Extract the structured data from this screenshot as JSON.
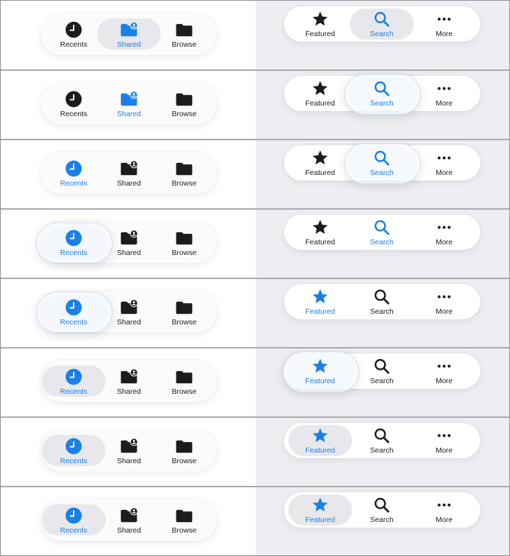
{
  "colors": {
    "accent": "#1a80e6",
    "icon_dark": "#1c1c1e",
    "pill": "#e8e8ec"
  },
  "files_tabs": {
    "recents": {
      "label": "Recents",
      "icon": "clock-icon"
    },
    "shared": {
      "label": "Shared",
      "icon": "folder-person-icon"
    },
    "browse": {
      "label": "Browse",
      "icon": "folder-icon"
    }
  },
  "store_tabs": {
    "featured": {
      "label": "Featured",
      "icon": "star-icon"
    },
    "search": {
      "label": "Search",
      "icon": "magnifying-glass-icon"
    },
    "more": {
      "label": "More",
      "icon": "ellipsis-icon"
    }
  },
  "frames": [
    {
      "left_selected": "shared",
      "right_selected": "search",
      "left_state": "pill",
      "right_state": "pill"
    },
    {
      "left_selected": "shared",
      "right_selected": "search",
      "left_state": "transition",
      "right_state": "glass"
    },
    {
      "left_selected": "recents",
      "right_selected": "search",
      "left_state": "transition",
      "right_state": "glass"
    },
    {
      "left_selected": "recents",
      "right_selected": "search",
      "left_state": "glass",
      "right_state": "transition"
    },
    {
      "left_selected": "recents",
      "right_selected": "featured",
      "left_state": "glass",
      "right_state": "transition"
    },
    {
      "left_selected": "recents",
      "right_selected": "featured",
      "left_state": "pill",
      "right_state": "glass"
    },
    {
      "left_selected": "recents",
      "right_selected": "featured",
      "left_state": "pill",
      "right_state": "pill"
    },
    {
      "left_selected": "recents",
      "right_selected": "featured",
      "left_state": "pill",
      "right_state": "pill"
    }
  ]
}
